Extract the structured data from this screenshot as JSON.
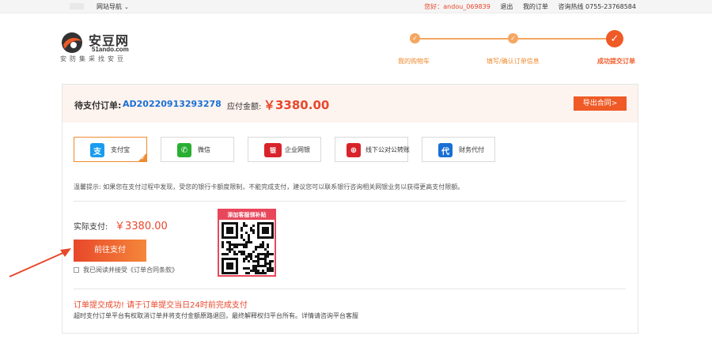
{
  "topbar": {
    "nav_label": "网站导航",
    "greeting": "您好：andou_069839",
    "logout": "退出",
    "my_orders": "我的订单",
    "hotline": "咨询热线 0755-23768584"
  },
  "brand": {
    "name": "安豆网",
    "domain": "51ando.com",
    "slogan": "安防集采找安豆",
    "accent": "#ef5a26"
  },
  "steps": [
    {
      "label": "我的购物车",
      "state": "done"
    },
    {
      "label": "填写/确认订单信息",
      "state": "done"
    },
    {
      "label": "成功提交订单",
      "state": "current"
    }
  ],
  "order": {
    "label": "待支付订单:",
    "number": "AD20220913293278",
    "amount_label": "应付金额:",
    "amount": "￥3380.00",
    "export_label": "导出合同>"
  },
  "payment_methods": [
    {
      "label": "支付宝",
      "icon": "alipay-icon",
      "selected": true,
      "color": "#1a9cf0",
      "glyph": "支"
    },
    {
      "label": "微信",
      "icon": "wechat-icon",
      "selected": false,
      "color": "#2aae32",
      "glyph": "✆"
    },
    {
      "label": "企业网银",
      "icon": "unionpay-icon",
      "selected": false,
      "color": "#d8232a",
      "glyph": "银"
    },
    {
      "label": "线下公对公转账",
      "icon": "transfer-icon",
      "selected": false,
      "color": "#d8232a",
      "glyph": "⊕"
    },
    {
      "label": "财务代付",
      "icon": "proxy-pay-icon",
      "selected": false,
      "color": "#1a6fd4",
      "glyph": "代"
    }
  ],
  "tip": "温馨提示: 如果您在支付过程中发现，受您的银行卡额度限制，不能完成支付，建议您可以联系银行咨询相关网银业务以获得更高支付限额。",
  "actual": {
    "label": "实际支付:",
    "amount": "￥3380.00"
  },
  "pay_button": "前往支付",
  "agreement": "我已阅读并接受《订单合同条款》",
  "qr": {
    "title": "添加客服领补贴"
  },
  "success_message": "订单提交成功! 请于订单提交当日24时前完成支付",
  "timeout_note": "超时支付订单平台有权取消订单并将支付金额原路退回，最终解释权归平台所有。详情请咨询平台客服"
}
